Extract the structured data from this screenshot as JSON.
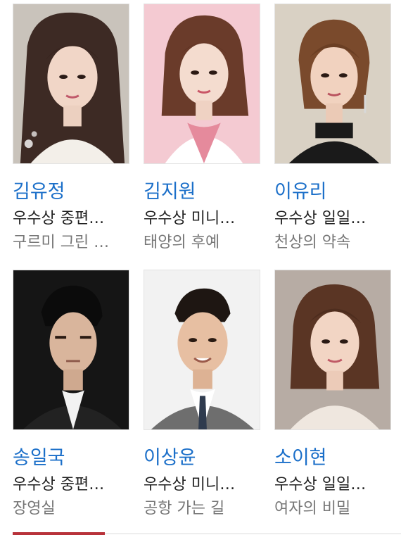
{
  "people": [
    {
      "name": "김유정",
      "award": "우수상 중편…",
      "work": "구르미 그린 …",
      "photo_icon": "portrait-photo"
    },
    {
      "name": "김지원",
      "award": "우수상 미니…",
      "work": "태양의 후예",
      "photo_icon": "portrait-photo"
    },
    {
      "name": "이유리",
      "award": "우수상 일일…",
      "work": "천상의 약속",
      "photo_icon": "portrait-photo"
    },
    {
      "name": "송일국",
      "award": "우수상 중편…",
      "work": "장영실",
      "photo_icon": "portrait-photo"
    },
    {
      "name": "이상윤",
      "award": "우수상 미니…",
      "work": "공항 가는 길",
      "photo_icon": "portrait-photo"
    },
    {
      "name": "소이현",
      "award": "우수상 일일…",
      "work": "여자의 비밀",
      "photo_icon": "portrait-photo"
    }
  ],
  "colors": {
    "name_link": "#1b6fc9",
    "award_text": "#222222",
    "work_text": "#777777",
    "page_indicator": "#b8323a"
  }
}
